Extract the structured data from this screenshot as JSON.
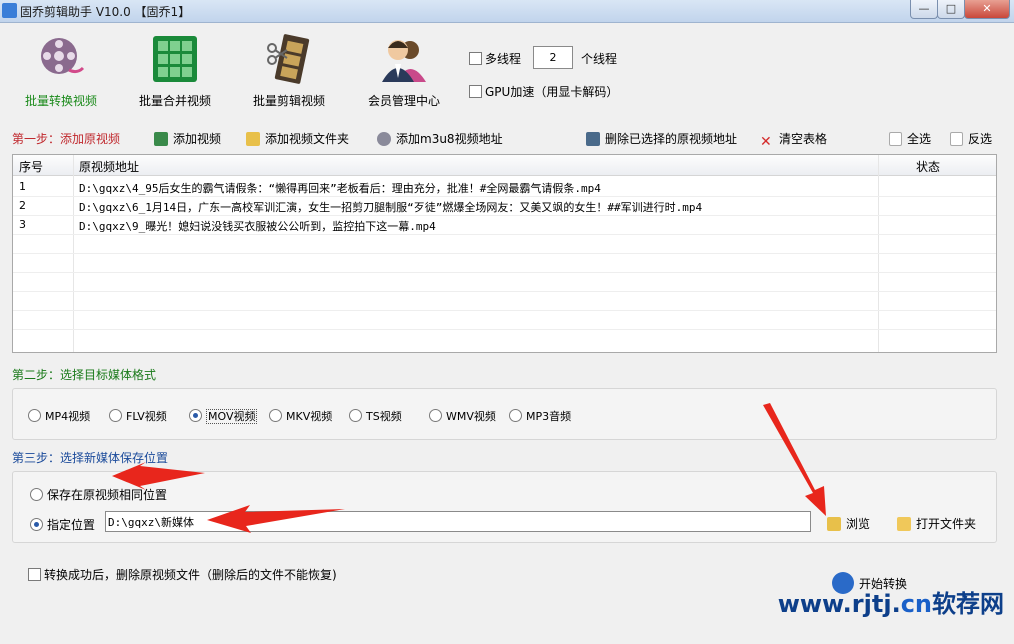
{
  "window": {
    "title": "固乔剪辑助手 V10.0 【固乔1】",
    "minimize": "—",
    "maximize": "□",
    "close": "✕"
  },
  "toolbar": {
    "items": [
      {
        "label": "批量转换视频",
        "icon": "film-reel-icon",
        "active": true
      },
      {
        "label": "批量合并视频",
        "icon": "film-grid-icon",
        "active": false
      },
      {
        "label": "批量剪辑视频",
        "icon": "film-strip-icon",
        "active": false
      },
      {
        "label": "会员管理中心",
        "icon": "users-icon",
        "active": false
      }
    ],
    "multithread_label": "多线程",
    "thread_count": "2",
    "thread_unit": "个线程",
    "gpu_label": "GPU加速（用显卡解码）"
  },
  "step1": {
    "title": "第一步：添加原视频",
    "add_video": "添加视频",
    "add_folder": "添加视频文件夹",
    "add_m3u8": "添加m3u8视频地址",
    "delete_selected": "删除已选择的原视频地址",
    "clear_table": "清空表格",
    "select_all": "全选",
    "invert_select": "反选"
  },
  "table": {
    "columns": [
      "序号",
      "原视频地址",
      "状态"
    ],
    "rows": [
      {
        "index": "1",
        "path": "D:\\gqxz\\4_95后女生的霸气请假条：“懒得再回来”老板看后：理由充分，批准！#全网最霸气请假条.mp4",
        "status": ""
      },
      {
        "index": "2",
        "path": "D:\\gqxz\\6_1月14日，广东一高校军训汇演，女生一招剪刀腿制服“歹徒”燃爆全场网友：又美又飒的女生！##军训进行时.mp4",
        "status": ""
      },
      {
        "index": "3",
        "path": "D:\\gqxz\\9_曝光！媳妇说没钱买衣服被公公听到，监控拍下这一幕.mp4",
        "status": ""
      }
    ]
  },
  "step2": {
    "title": "第二步：选择目标媒体格式",
    "formats": [
      "MP4视频",
      "FLV视频",
      "MOV视频",
      "MKV视频",
      "TS视频",
      "WMV视频",
      "MP3音频"
    ],
    "selected": "MOV视频"
  },
  "step3": {
    "title": "第三步：选择新媒体保存位置",
    "same_location": "保存在原视频相同位置",
    "specified_location": "指定位置",
    "path_value": "D:\\gqxz\\新媒体",
    "browse": "浏览",
    "open_folder": "打开文件夹"
  },
  "footer": {
    "delete_after": "转换成功后，删除原视频文件（删除后的文件不能恢复)",
    "start": "开始转换"
  },
  "watermark": {
    "prefix": "www.rjtj.",
    "cn": "cn",
    "suffix": "软荐网"
  },
  "colors": {
    "step1": "#c0282d",
    "step2": "#1a7a1a",
    "step3": "#1a4a9a",
    "arrow": "#e8261c"
  }
}
